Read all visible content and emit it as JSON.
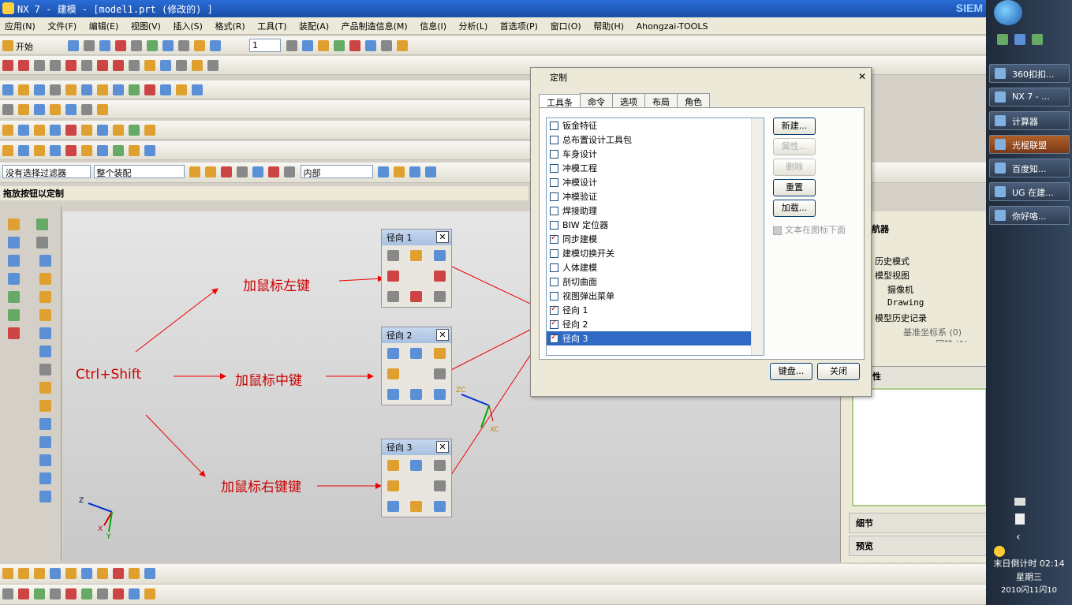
{
  "window": {
    "title": "NX 7 - 建模 - [model1.prt  (修改的) ]",
    "brand": "SIEM"
  },
  "menu": [
    "应用(N)",
    "文件(F)",
    "编辑(E)",
    "视图(V)",
    "插入(S)",
    "格式(R)",
    "工具(T)",
    "装配(A)",
    "产品制造信息(M)",
    "信息(I)",
    "分析(L)",
    "首选项(P)",
    "窗口(O)",
    "帮助(H)",
    "Ahongzai-TOOLS"
  ],
  "toolbar": {
    "start_label": "开始",
    "layer_value": "1"
  },
  "filter": {
    "select_filter": "没有选择过滤器",
    "assembly_scope": "整个装配",
    "inner": "内部"
  },
  "status_text": "拖放按钮以定制",
  "viewport": {
    "labels": {
      "ctrl_shift": "Ctrl+Shift",
      "left": "加鼠标左键",
      "middle": "加鼠标中键",
      "right": "加鼠标右键键"
    },
    "radial1_title": "径向 1",
    "radial2_title": "径向 2",
    "radial3_title": "径向 3",
    "axes": {
      "z": "Z",
      "x": "X",
      "y": "Y",
      "zc": "ZC",
      "xc": "XC"
    }
  },
  "dialog": {
    "title": "定制",
    "tabs": [
      "工具条",
      "命令",
      "选项",
      "布局",
      "角色"
    ],
    "items": [
      {
        "label": "钣金特征",
        "checked": false
      },
      {
        "label": "总布置设计工具包",
        "checked": false
      },
      {
        "label": "车身设计",
        "checked": false
      },
      {
        "label": "冲模工程",
        "checked": false
      },
      {
        "label": "冲模设计",
        "checked": false
      },
      {
        "label": "冲模验证",
        "checked": false
      },
      {
        "label": "焊接助理",
        "checked": false
      },
      {
        "label": "BIW 定位器",
        "checked": false
      },
      {
        "label": "同步建模",
        "checked": true
      },
      {
        "label": "建模切换开关",
        "checked": false
      },
      {
        "label": "人体建模",
        "checked": false
      },
      {
        "label": "剖切曲面",
        "checked": false
      },
      {
        "label": "视图弹出菜单",
        "checked": false
      },
      {
        "label": "径向 1",
        "checked": true
      },
      {
        "label": "径向 2",
        "checked": true
      },
      {
        "label": "径向 3",
        "checked": true
      }
    ],
    "buttons": {
      "new": "新建...",
      "props": "属性...",
      "delete": "删除",
      "reset": "重置",
      "load": "加载...",
      "keyboard": "键盘...",
      "close": "关闭"
    },
    "text_below_icon": "文本在图标下面"
  },
  "nav": {
    "title": "航器",
    "history_mode": "历史模式",
    "model_views": "模型视图",
    "camera": "摄像机",
    "drawing": "Drawing",
    "model_history": "模型历史记录",
    "datum_csys": "基准坐标系 (0)",
    "body": "回转 (1)",
    "props": "性",
    "details": "细节",
    "preview": "预览"
  },
  "taskbar": {
    "items": [
      "360扣扣...",
      "NX 7 - ...",
      "计算器",
      "光棍联盟",
      "百度知...",
      "UG 在建...",
      "你好咯..."
    ],
    "clock": {
      "line1": "末日倒计时 02:14",
      "line2": "星期三",
      "line3": "2010闪11闪10"
    }
  }
}
